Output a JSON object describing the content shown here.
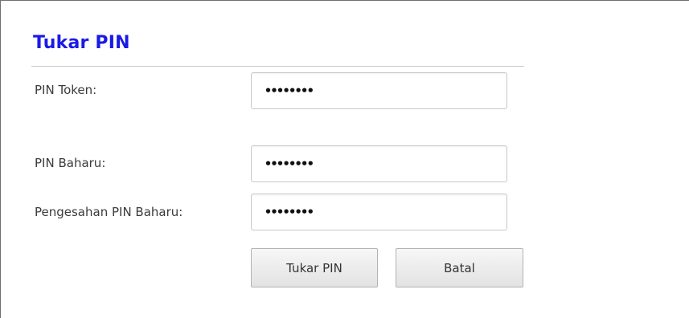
{
  "form": {
    "title": "Tukar PIN",
    "fields": [
      {
        "label": "PIN Token:",
        "value_mask": "••••••••"
      },
      {
        "label": "PIN Baharu:",
        "value_mask": "••••••••"
      },
      {
        "label": "Pengesahan PIN Baharu:",
        "value_mask": "••••••••"
      }
    ],
    "buttons": {
      "submit_label": "Tukar PIN",
      "cancel_label": "Batal"
    }
  },
  "colors": {
    "title": "#1a1ae6",
    "label": "#3c3c3c",
    "border": "#c9c9c9"
  }
}
